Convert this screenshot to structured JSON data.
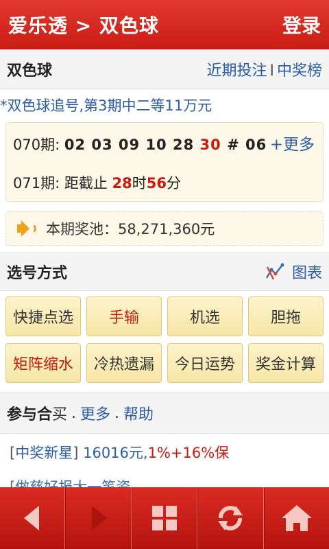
{
  "header": {
    "title": "爱乐透 > 双色球",
    "login": "登录"
  },
  "subheader": {
    "game_name": "双色球",
    "recent_bets": "近期投注",
    "separator": "I",
    "winners_board": "中奖榜"
  },
  "promo_text": "*双色球追号,第3期中二等11万元",
  "draw": {
    "prev_label": "070期: ",
    "prev_numbers": "02 03 09 10 28 ",
    "prev_red_highlight": "30",
    "prev_tail": " # 06",
    "more": "+更多",
    "next_label": "071期: 距截止 ",
    "next_hours": "28",
    "next_hours_unit": "时",
    "next_minutes": "56",
    "next_minutes_unit": "分"
  },
  "pool": {
    "icon": "speaker-icon",
    "text": "本期奖池：58,271,360元"
  },
  "pick_section": {
    "title": "选号方式",
    "chart_label": "图表",
    "chart_icon": "chart-icon"
  },
  "pick_buttons": [
    {
      "label": "快捷点选",
      "highlight": false
    },
    {
      "label": "手输",
      "highlight": true
    },
    {
      "label": "机选",
      "highlight": false
    },
    {
      "label": "胆拖",
      "highlight": false
    },
    {
      "label": "矩阵缩水",
      "highlight": true
    },
    {
      "label": "冷热遗漏",
      "highlight": false
    },
    {
      "label": "今日运势",
      "highlight": false
    },
    {
      "label": "奖金计算",
      "highlight": false
    }
  ],
  "group_buy": {
    "title": "参与合",
    "title_tail": "买",
    "dot": ".",
    "more": "更多",
    "help": "帮助"
  },
  "list": [
    {
      "tag": "中奖新星",
      "amount": "16016元,",
      "pct": "1%+16%保"
    },
    {
      "tag": "做慈好报大一笔资",
      "amount": "",
      "pct": ""
    }
  ],
  "colors": {
    "primary_red": "#cc1a10",
    "link_blue": "#2a5ca8",
    "button_bg": "#f6e6a6"
  },
  "bottom_nav": [
    {
      "name": "back-arrow-icon"
    },
    {
      "name": "forward-arrow-icon"
    },
    {
      "name": "grid-menu-icon"
    },
    {
      "name": "refresh-icon"
    },
    {
      "name": "home-icon"
    }
  ]
}
